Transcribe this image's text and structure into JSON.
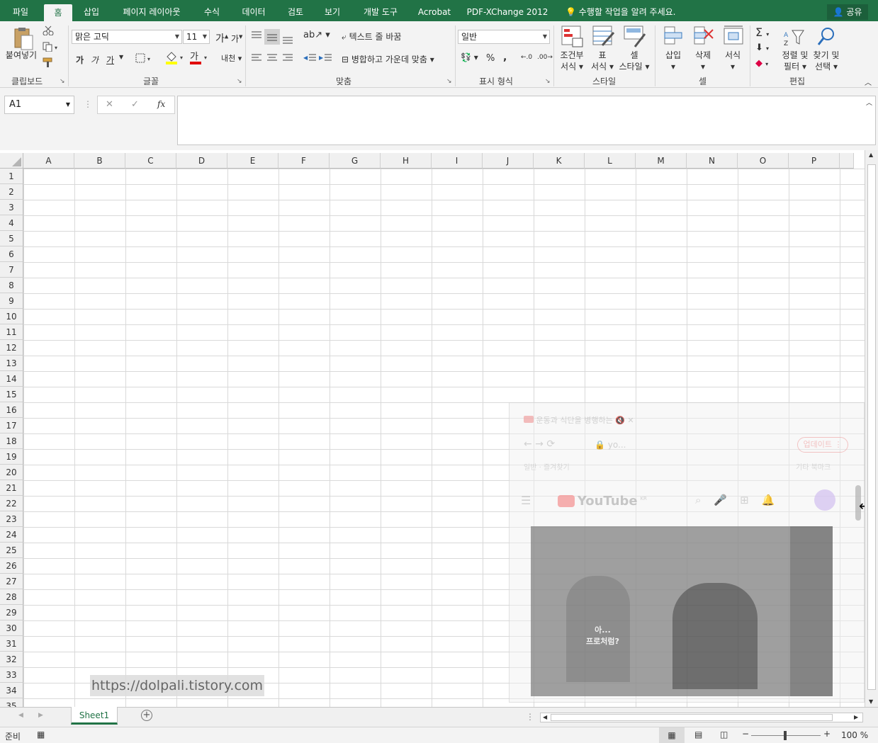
{
  "tabs": {
    "file": "파일",
    "home": "홈",
    "insert": "삽입",
    "page_layout": "페이지 레이아웃",
    "formulas": "수식",
    "data": "데이터",
    "review": "검토",
    "view": "보기",
    "developer": "개발 도구",
    "acrobat": "Acrobat",
    "pdfx": "PDF-XChange 2012"
  },
  "tell_me": "수행할 작업을 알려 주세요.",
  "share": "공유",
  "ribbon": {
    "clipboard": {
      "paste": "붙여넣기",
      "label": "클립보드"
    },
    "font": {
      "name": "맑은 고딕",
      "size": "11",
      "bold": "가",
      "italic": "가",
      "underline": "가",
      "fontcolor": "가",
      "label": "글꼴",
      "grow": "가",
      "shrink": "가",
      "phonetic": "내천"
    },
    "alignment": {
      "wrap": "텍스트 줄 바꿈",
      "merge": "병합하고 가운데 맞춤",
      "label": "맞춤"
    },
    "number": {
      "format": "일반",
      "percent": "%",
      "comma": ",",
      "label": "표시 형식"
    },
    "styles": {
      "conditional": "조건부",
      "conditional2": "서식",
      "table": "표",
      "table2": "서식",
      "cell": "셀",
      "cell2": "스타일",
      "label": "스타일"
    },
    "cells": {
      "insert": "삽입",
      "delete": "삭제",
      "format": "서식",
      "label": "셀"
    },
    "editing": {
      "sort": "정렬 및",
      "sort2": "필터",
      "find": "찾기 및",
      "find2": "선택",
      "label": "편집"
    }
  },
  "namebox": "A1",
  "fx": "fx",
  "columns": [
    "A",
    "B",
    "C",
    "D",
    "E",
    "F",
    "G",
    "H",
    "I",
    "J",
    "K",
    "L",
    "M",
    "N",
    "O",
    "P"
  ],
  "rows": [
    "1",
    "2",
    "3",
    "4",
    "5",
    "6",
    "7",
    "8",
    "9",
    "10",
    "11",
    "12",
    "13",
    "14",
    "15",
    "16",
    "17",
    "18",
    "19",
    "20",
    "21",
    "22",
    "23",
    "24",
    "25",
    "26",
    "27",
    "28",
    "29",
    "30",
    "31",
    "32",
    "33",
    "34",
    "35"
  ],
  "sheet_tab": "Sheet1",
  "status": {
    "ready": "준비",
    "zoom": "100 %"
  },
  "watermark": "https://dolpali.tistory.com",
  "overlay": {
    "tab_title": "운동과 식단을 병행하는",
    "address": "yo...",
    "update": "업데이트",
    "bookmark1": "일반",
    "bookmark2": "즐겨찾기",
    "bookmark3": "기타 북마크",
    "youtube": "YouTube",
    "kr": "KR",
    "video_caption1": "아...",
    "video_caption2": "프로처럼?"
  },
  "colors": {
    "excel_green": "#217346"
  }
}
